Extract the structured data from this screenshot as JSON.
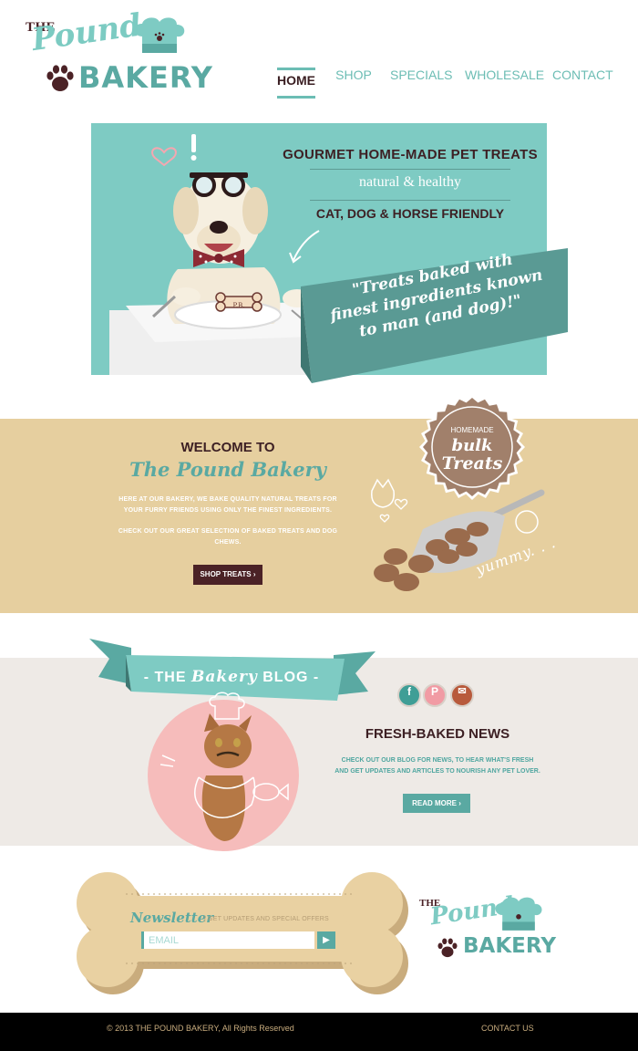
{
  "brand": {
    "the": "THE",
    "pound": "Pound",
    "bakery": "BAKERY"
  },
  "nav": {
    "items": [
      "HOME",
      "SHOP",
      "SPECIALS",
      "WHOLESALE",
      "CONTACT"
    ],
    "active": "HOME"
  },
  "hero": {
    "line1": "GOURMET HOME-MADE PET TREATS",
    "line2": "natural & healthy",
    "line3": "CAT, DOG & HORSE FRIENDLY",
    "quote_l1": "\"Treats baked with",
    "quote_l2": "finest ingredients known",
    "quote_l3": "to man (and dog)!\"",
    "bone_label": "P.B."
  },
  "welcome": {
    "heading": "WELCOME TO",
    "name": "The Pound Bakery",
    "p1_l1": "HERE AT OUR BAKERY,  WE BAKE QUALITY NATURAL TREATS FOR",
    "p1_l2": "YOUR FURRY FRIENDS USING ONLY THE FINEST INGREDIENTS.",
    "p2_l1": "CHECK OUT OUR GREAT SELECTION OF BAKED TREATS AND DOG",
    "p2_l2": "CHEWS.",
    "button": "SHOP TREATS ›",
    "badge_top": "HOMEMADE",
    "badge_mid": "bulk",
    "badge_bottom": "Treats",
    "yummy": "yummy. . ."
  },
  "blog": {
    "ribbon_prefix": "- THE",
    "ribbon_script": "Bakery",
    "ribbon_suffix": "BLOG -",
    "social": [
      {
        "name": "facebook-icon",
        "glyph": "f",
        "color": "#3f9e96"
      },
      {
        "name": "pinterest-icon",
        "glyph": "P",
        "color": "#f19ba4"
      },
      {
        "name": "email-icon",
        "glyph": "✉",
        "color": "#b85a3c"
      }
    ],
    "heading": "FRESH-BAKED NEWS",
    "p_l1": "CHECK OUT OUR BLOG FOR NEWS, TO HEAR WHAT'S FRESH",
    "p_l2": "AND GET UPDATES AND ARTICLES TO NOURISH ANY PET LOVER.",
    "button": "READ MORE ›"
  },
  "newsletter": {
    "title": "Newsletter",
    "subtitle": "| GET UPDATES AND SPECIAL OFFERS",
    "placeholder": "EMAIL",
    "go": "▶"
  },
  "footer": {
    "copyright": "© 2013  THE POUND BAKERY, All Rights Reserved",
    "contact": "CONTACT US"
  },
  "colors": {
    "teal": "#7ecbc3",
    "dark_teal": "#5aa9a2",
    "brown": "#4b2226",
    "tan": "#e6cf9f",
    "pink": "#f6bcbb"
  }
}
